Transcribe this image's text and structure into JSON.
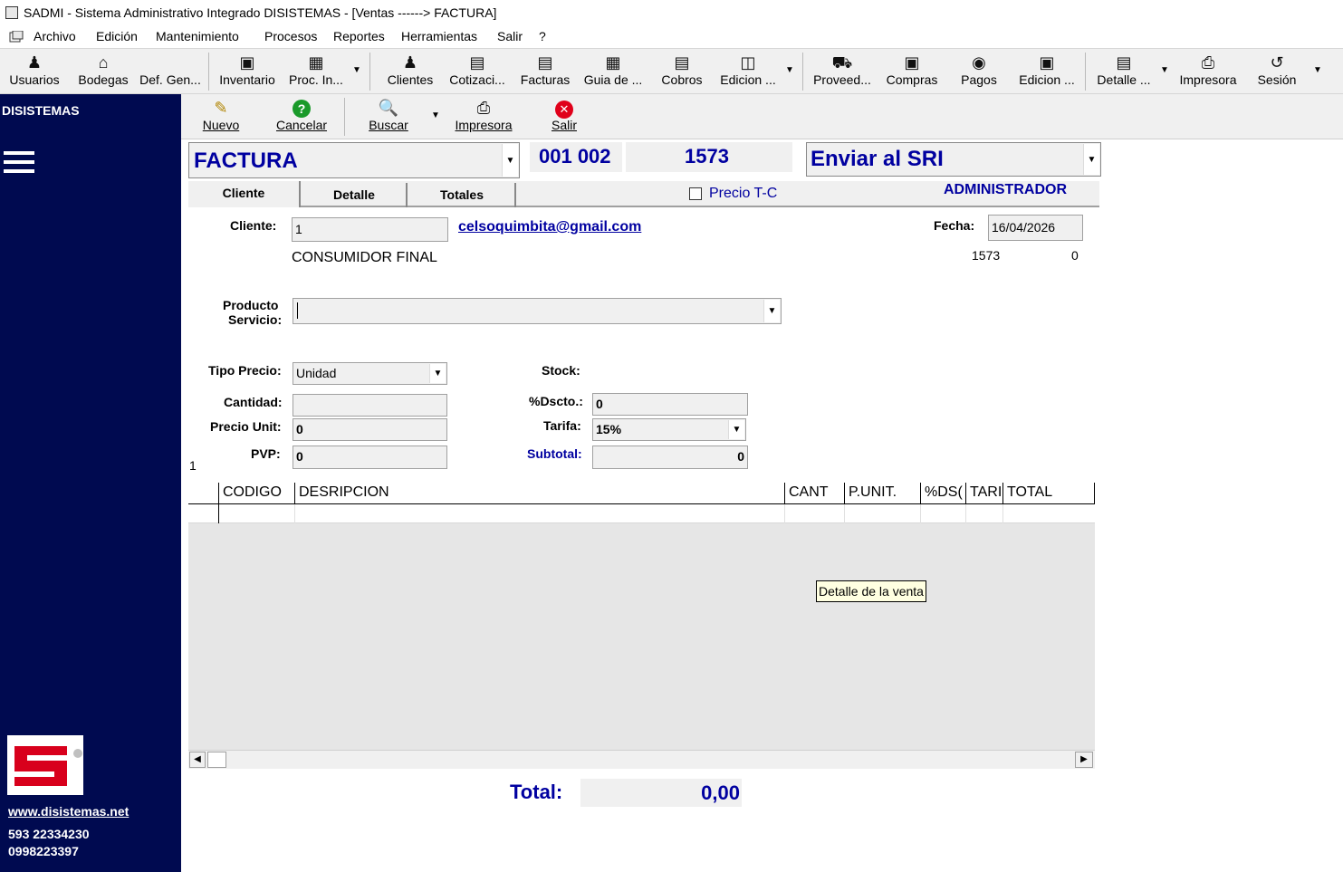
{
  "window": {
    "title": "SADMI - Sistema Administrativo Integrado DISISTEMAS - [Ventas ------> FACTURA]"
  },
  "menu": [
    "Archivo",
    "Edición",
    "Mantenimiento",
    "Procesos",
    "Reportes",
    "Herramientas",
    "Salir",
    "?"
  ],
  "toolbar": {
    "items": [
      "Usuarios",
      "Bodegas",
      "Def. Gen...",
      "Inventario",
      "Proc. In...",
      "Clientes",
      "Cotizaci...",
      "Facturas",
      "Guia de ...",
      "Cobros",
      "Edicion ...",
      "Proveed...",
      "Compras",
      "Pagos",
      "Edicion ...",
      "Detalle ...",
      "Impresora",
      "Sesión"
    ],
    "icons": [
      "user-icon",
      "house-icon",
      "gear-icon",
      "inventory-icon",
      "table-icon",
      "people-icon",
      "chart-icon",
      "document-icon",
      "chart-icon",
      "book-icon",
      "edit-icon",
      "truck-icon",
      "lock-icon",
      "money-icon",
      "lock-icon",
      "detail-icon",
      "printer-icon",
      "logout-icon"
    ]
  },
  "subtoolbar": {
    "nuevo": "Nuevo",
    "cancelar": "Cancelar",
    "buscar": "Buscar",
    "impresora": "Impresora",
    "salir": "Salir"
  },
  "sidebar": {
    "company": "DISISTEMAS",
    "website": "www.disistemas.net",
    "phone1": "593 22334230",
    "phone2": "0998223397"
  },
  "document": {
    "type": "FACTURA",
    "series": "001 002",
    "number": "1573",
    "sri_action": "Enviar al SRI",
    "user": "ADMINISTRADOR"
  },
  "tabs": [
    "Cliente",
    "Detalle",
    "Totales"
  ],
  "precio_tc": "Precio T-C",
  "form": {
    "cliente_label": "Cliente:",
    "cliente_value": "1",
    "email": "celsoquimbita@gmail.com",
    "client_name": "CONSUMIDOR FINAL",
    "fecha_label": "Fecha:",
    "fecha_value": "16/04/2026",
    "info_number": "1573",
    "info_zero": "0",
    "producto_label": "Producto",
    "servicio_label": "Servicio:",
    "producto_value": "",
    "tipo_precio_label": "Tipo Precio:",
    "tipo_precio_value": "Unidad",
    "stock_label": "Stock:",
    "cantidad_label": "Cantidad:",
    "cantidad_value": "",
    "dscto_label": "%Dscto.:",
    "dscto_value": "0",
    "precio_unit_label": "Precio Unit:",
    "precio_unit_value": "0",
    "tarifa_label": "Tarifa:",
    "tarifa_value": "15%",
    "pvp_label": "PVP:",
    "pvp_value": "0",
    "subtotal_label": "Subtotal:",
    "subtotal_value": "0",
    "row_indicator": "1"
  },
  "grid": {
    "columns": [
      "CODIGO",
      "DESRIPCION",
      "CANT",
      "P.UNIT.",
      "%DS(",
      "TARI",
      "TOTAL"
    ],
    "tooltip": "Detalle de la venta"
  },
  "totals": {
    "label": "Total:",
    "value": "0,00"
  },
  "colors": {
    "sidebar": "#000a50",
    "accent_blue": "#0000a0",
    "logo_red": "#d8001c"
  }
}
